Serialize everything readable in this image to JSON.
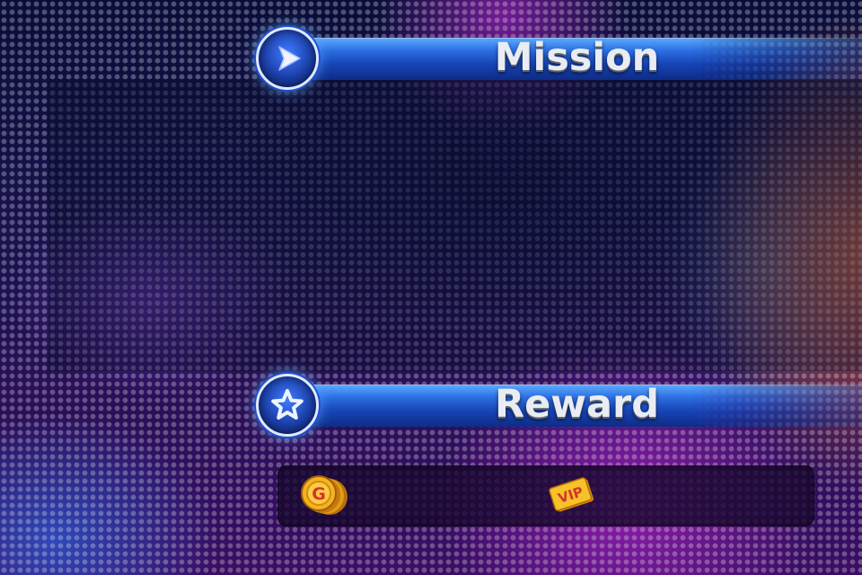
{
  "mission": {
    "title": "Mission",
    "icon": "play-arrow-icon"
  },
  "reward": {
    "title": "Reward",
    "icon": "star-icon",
    "items": [
      {
        "icon": "gold-coin-stack-icon",
        "coin_letter": "G"
      },
      {
        "icon": "vip-ticket-icon",
        "ticket_label": "VIP"
      }
    ]
  },
  "colors": {
    "banner_blue": "#2b6de0",
    "title_text": "#e9ecf2",
    "coin_gold": "#f4b41e"
  }
}
